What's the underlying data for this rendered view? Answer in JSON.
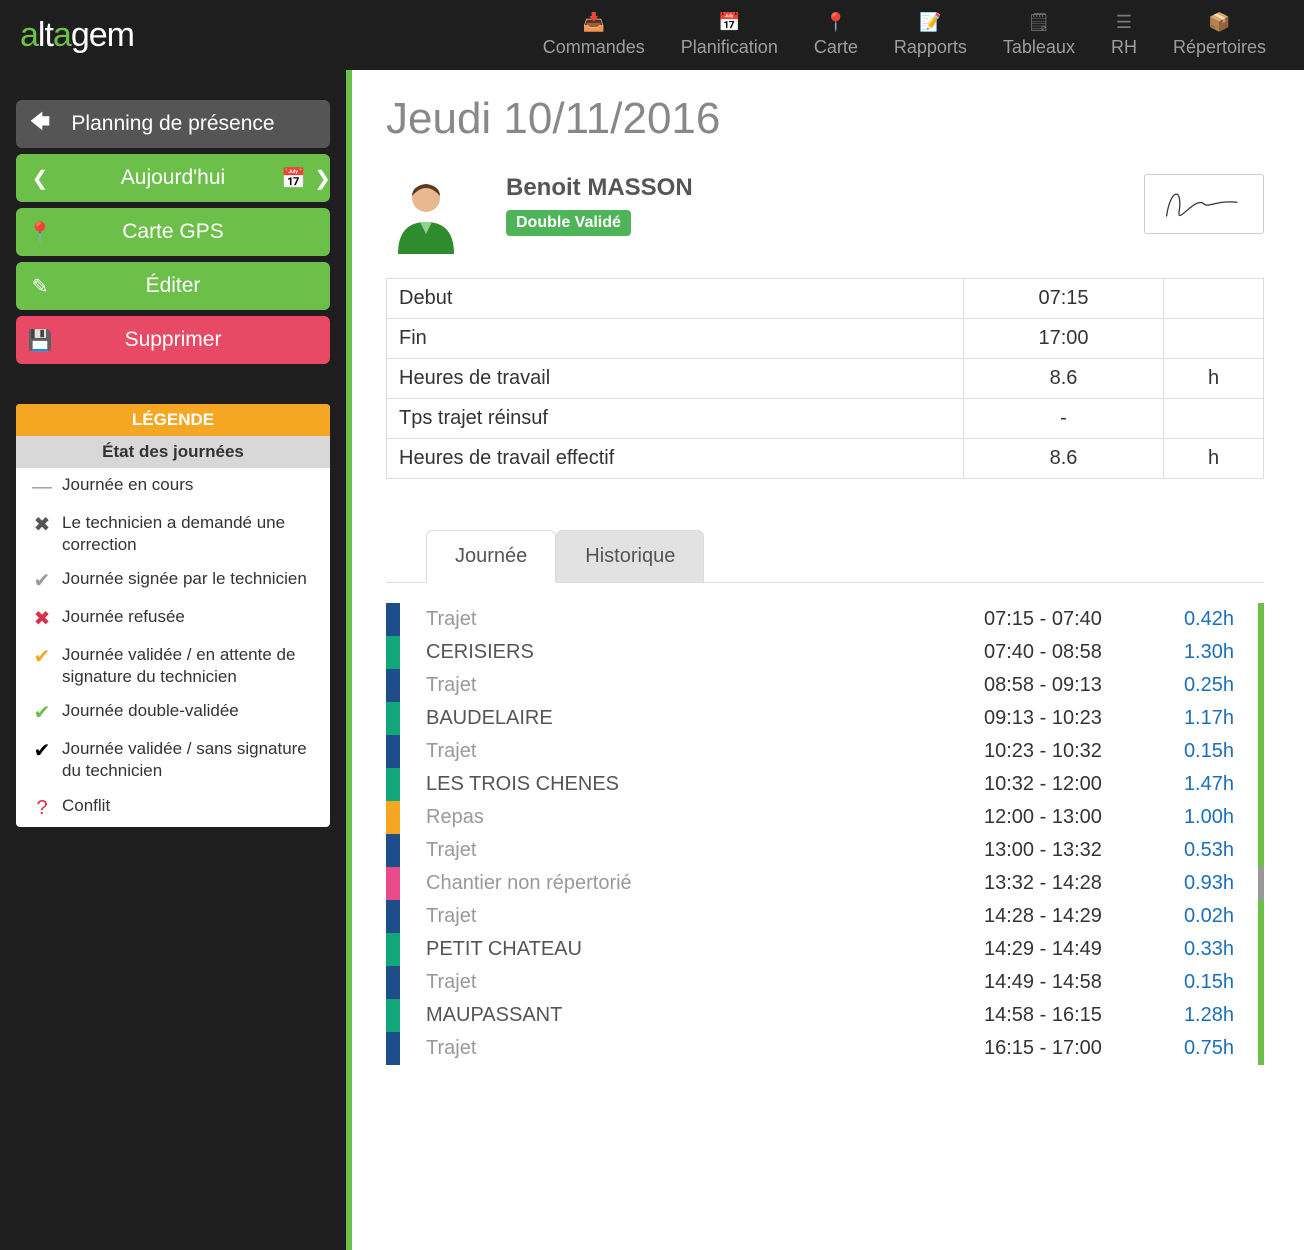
{
  "logo": "altagem",
  "nav": [
    {
      "label": "Commandes",
      "glyph": "📥"
    },
    {
      "label": "Planification",
      "glyph": "📅"
    },
    {
      "label": "Carte",
      "glyph": "📍"
    },
    {
      "label": "Rapports",
      "glyph": "📝"
    },
    {
      "label": "Tableaux",
      "glyph": "🗒"
    },
    {
      "label": "RH",
      "glyph": "☰"
    },
    {
      "label": "Répertoires",
      "glyph": "📦"
    }
  ],
  "sidebar": {
    "presence": "Planning de présence",
    "today": "Aujourd'hui",
    "map": "Carte GPS",
    "edit": "Éditer",
    "delete": "Supprimer"
  },
  "legend": {
    "title": "LÉGENDE",
    "subtitle": "État des journées",
    "items": [
      {
        "glyph": "—",
        "cls": "ic-grey",
        "text": "Journée en cours"
      },
      {
        "glyph": "✖",
        "cls": "ic-dark",
        "text": "Le technicien a demandé une correction"
      },
      {
        "glyph": "✔",
        "cls": "ic-grey",
        "text": "Journée signée par le technicien"
      },
      {
        "glyph": "✖",
        "cls": "ic-red",
        "text": "Journée refusée"
      },
      {
        "glyph": "✔",
        "cls": "ic-org",
        "text": "Journée validée / en attente de signature du technicien"
      },
      {
        "glyph": "✔",
        "cls": "ic-grn",
        "text": "Journée double-validée"
      },
      {
        "glyph": "✔",
        "cls": "ic-black",
        "text": "Journée validée / sans signature du technicien"
      },
      {
        "glyph": "?",
        "cls": "ic-red",
        "text": "Conflit"
      }
    ]
  },
  "page": {
    "title": "Jeudi 10/11/2016",
    "employee_name": "Benoit MASSON",
    "status_badge": "Double Validé"
  },
  "summary": [
    {
      "label": "Debut",
      "value": "07:15",
      "unit": ""
    },
    {
      "label": "Fin",
      "value": "17:00",
      "unit": ""
    },
    {
      "label": "Heures de travail",
      "value": "8.6",
      "unit": "h"
    },
    {
      "label": "Tps trajet réinsuf",
      "value": "-",
      "unit": ""
    },
    {
      "label": "Heures de travail effectif",
      "value": "8.6",
      "unit": "h"
    }
  ],
  "tabs": {
    "day": "Journée",
    "history": "Historique"
  },
  "day_entries": [
    {
      "activity": "Trajet",
      "range": "07:15 - 07:40",
      "dur": "0.42h",
      "left": "c-blue",
      "right": "c-green",
      "muted": true
    },
    {
      "activity": "CERISIERS",
      "range": "07:40 - 08:58",
      "dur": "1.30h",
      "left": "c-teal",
      "right": "c-green",
      "muted": false
    },
    {
      "activity": "Trajet",
      "range": "08:58 - 09:13",
      "dur": "0.25h",
      "left": "c-blue",
      "right": "c-green",
      "muted": true
    },
    {
      "activity": "BAUDELAIRE",
      "range": "09:13 - 10:23",
      "dur": "1.17h",
      "left": "c-teal",
      "right": "c-green",
      "muted": false
    },
    {
      "activity": "Trajet",
      "range": "10:23 - 10:32",
      "dur": "0.15h",
      "left": "c-blue",
      "right": "c-green",
      "muted": true
    },
    {
      "activity": "LES TROIS CHENES",
      "range": "10:32 - 12:00",
      "dur": "1.47h",
      "left": "c-teal",
      "right": "c-green",
      "muted": false
    },
    {
      "activity": "Repas",
      "range": "12:00 - 13:00",
      "dur": "1.00h",
      "left": "c-orange",
      "right": "c-green",
      "muted": true
    },
    {
      "activity": "Trajet",
      "range": "13:00 - 13:32",
      "dur": "0.53h",
      "left": "c-blue",
      "right": "c-green",
      "muted": true
    },
    {
      "activity": "Chantier non répertorié",
      "range": "13:32 - 14:28",
      "dur": "0.93h",
      "left": "c-pink",
      "right": "c-grey",
      "muted": true
    },
    {
      "activity": "Trajet",
      "range": "14:28 - 14:29",
      "dur": "0.02h",
      "left": "c-blue",
      "right": "c-green",
      "muted": true
    },
    {
      "activity": "PETIT CHATEAU",
      "range": "14:29 - 14:49",
      "dur": "0.33h",
      "left": "c-teal",
      "right": "c-green",
      "muted": false
    },
    {
      "activity": "Trajet",
      "range": "14:49 - 14:58",
      "dur": "0.15h",
      "left": "c-blue",
      "right": "c-green",
      "muted": true
    },
    {
      "activity": "MAUPASSANT",
      "range": "14:58 - 16:15",
      "dur": "1.28h",
      "left": "c-teal",
      "right": "c-green",
      "muted": false
    },
    {
      "activity": "Trajet",
      "range": "16:15 - 17:00",
      "dur": "0.75h",
      "left": "c-blue",
      "right": "c-green",
      "muted": true
    }
  ]
}
